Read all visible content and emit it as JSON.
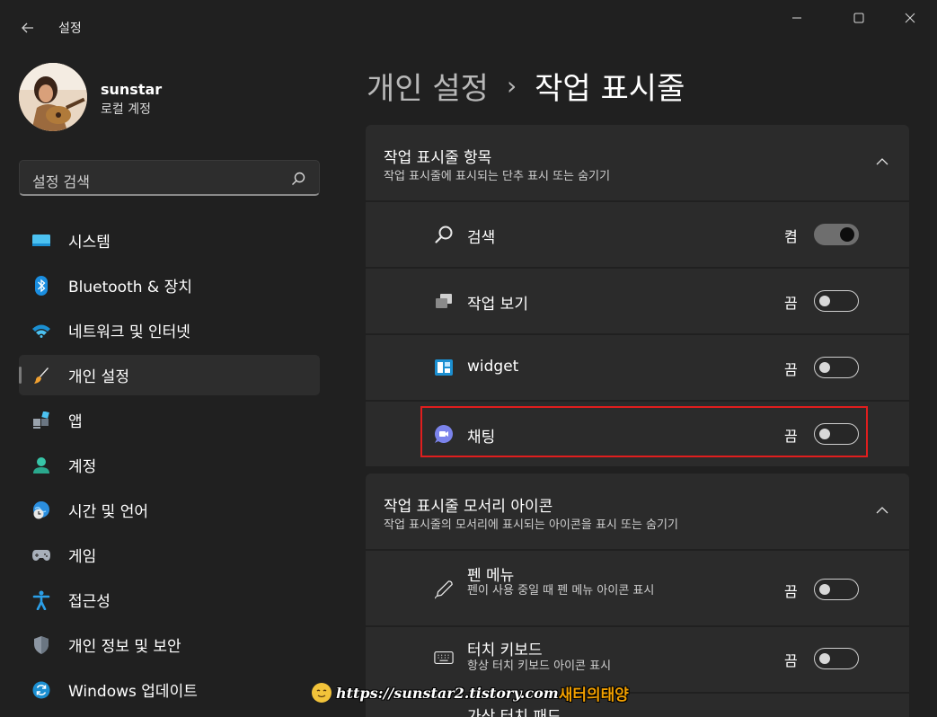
{
  "window": {
    "title": "설정",
    "controls": [
      "minimize-icon",
      "maximize-icon",
      "close-icon"
    ]
  },
  "profile": {
    "name": "sunstar",
    "account_type": "로컬 계정"
  },
  "search": {
    "placeholder": "설정 검색",
    "icon": "search-icon"
  },
  "sidebar": {
    "items": [
      {
        "label": "시스템",
        "icon": "display-icon",
        "active": false
      },
      {
        "label": "Bluetooth & 장치",
        "icon": "bluetooth-icon",
        "active": false
      },
      {
        "label": "네트워크 및 인터넷",
        "icon": "wifi-icon",
        "active": false
      },
      {
        "label": "개인 설정",
        "icon": "brush-icon",
        "active": true
      },
      {
        "label": "앱",
        "icon": "apps-icon",
        "active": false
      },
      {
        "label": "계정",
        "icon": "person-icon",
        "active": false
      },
      {
        "label": "시간 및 언어",
        "icon": "globe-clock-icon",
        "active": false
      },
      {
        "label": "게임",
        "icon": "gamepad-icon",
        "active": false
      },
      {
        "label": "접근성",
        "icon": "accessibility-icon",
        "active": false
      },
      {
        "label": "개인 정보 및 보안",
        "icon": "shield-icon",
        "active": false
      },
      {
        "label": "Windows 업데이트",
        "icon": "update-icon",
        "active": false
      }
    ]
  },
  "breadcrumb": {
    "parent": "개인 설정",
    "separator": "›",
    "current": "작업 표시줄"
  },
  "sections": [
    {
      "title": "작업 표시줄 항목",
      "subtitle": "작업 표시줄에 표시되는 단추 표시 또는 숨기기",
      "rows": [
        {
          "label": "검색",
          "state": "켬",
          "on": true,
          "icon": "search-icon"
        },
        {
          "label": "작업 보기",
          "state": "끔",
          "on": false,
          "icon": "task-view-icon"
        },
        {
          "label": "widget",
          "state": "끔",
          "on": false,
          "icon": "widgets-icon"
        },
        {
          "label": "채팅",
          "state": "끔",
          "on": false,
          "icon": "chat-icon"
        }
      ]
    },
    {
      "title": "작업 표시줄 모서리 아이콘",
      "subtitle": "작업 표시줄의 모서리에 표시되는 아이콘을 표시 또는 숨기기",
      "rows": [
        {
          "label": "펜 메뉴",
          "sub": "펜이 사용 중일 때 펜 메뉴 아이콘 표시",
          "state": "끔",
          "on": false,
          "icon": "pen-icon"
        },
        {
          "label": "터치 키보드",
          "sub": "항상 터치 키보드 아이콘 표시",
          "state": "끔",
          "on": false,
          "icon": "keyboard-icon"
        },
        {
          "label": "가상 터치 패드",
          "icon": "touchpad-icon"
        }
      ]
    }
  ],
  "watermark": {
    "url": "https://sunstar2.tistory.com",
    "name": "새터의태양"
  },
  "colors": {
    "background": "#202020",
    "card": "#2b2b2b",
    "highlight_border": "#e01e1e"
  }
}
